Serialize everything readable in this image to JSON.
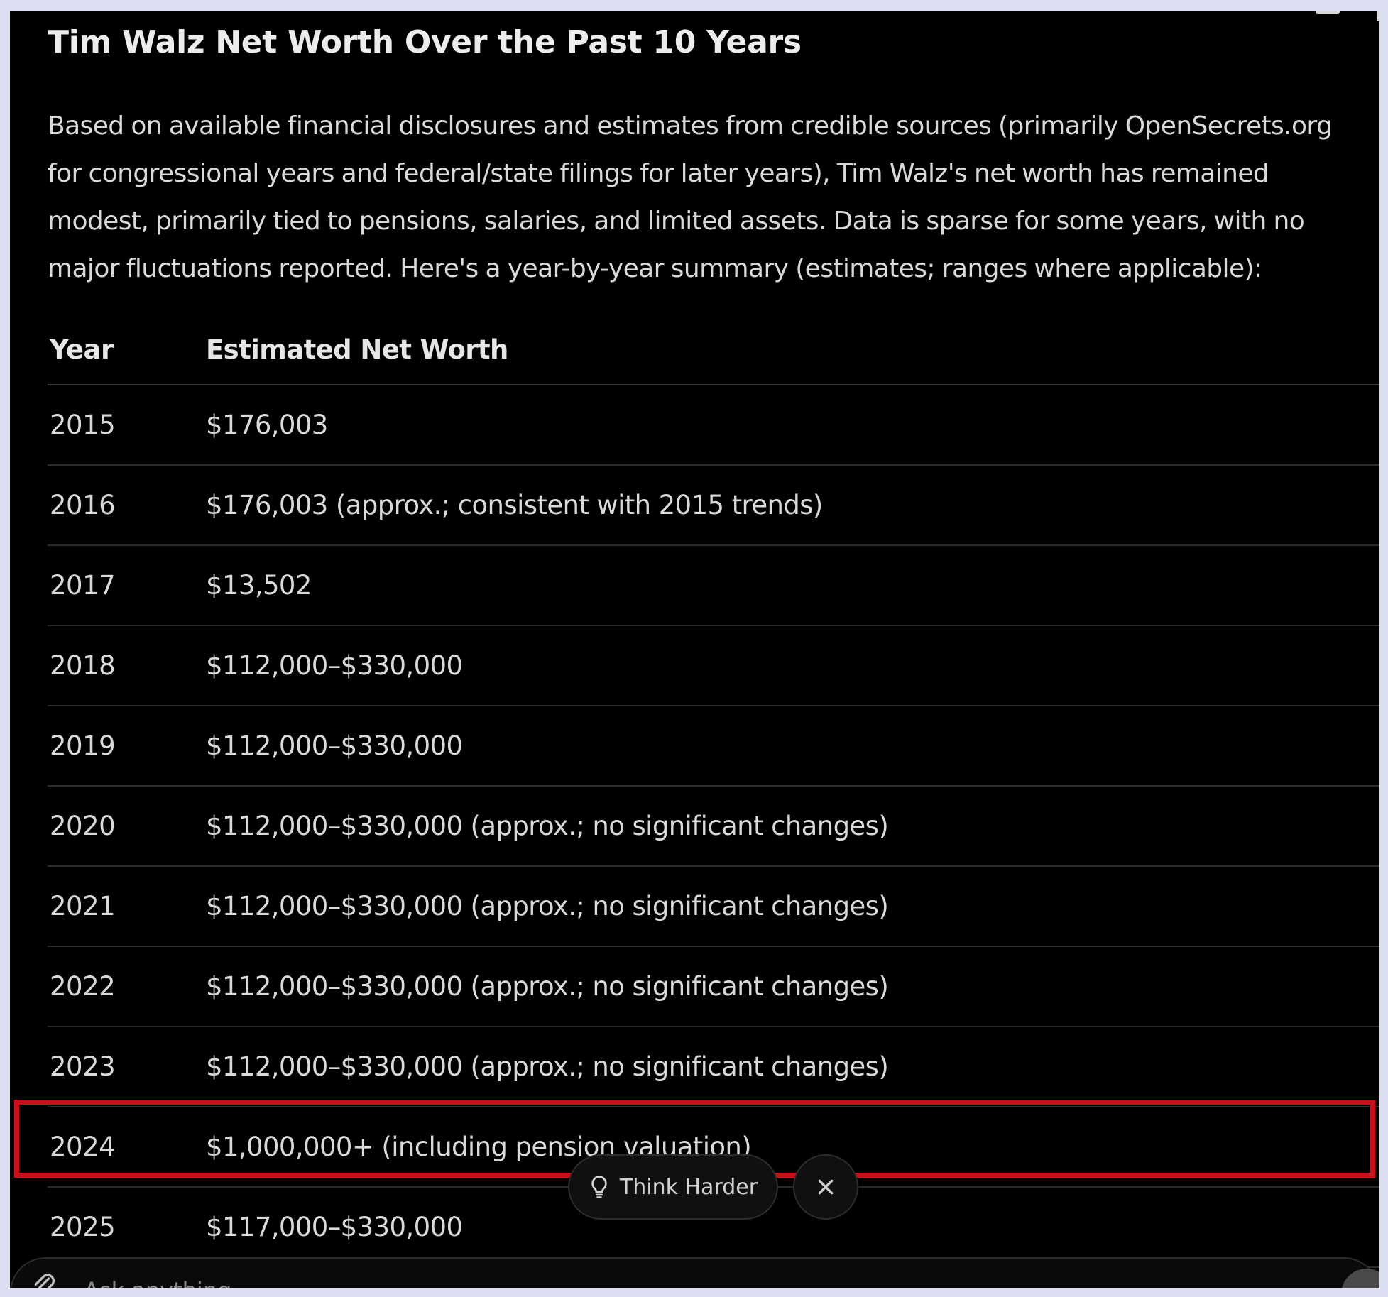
{
  "article": {
    "title": "Tim Walz Net Worth Over the Past 10 Years",
    "intro": "Based on available financial disclosures and estimates from credible sources (primarily OpenSecrets.org for congressional years and federal/state filings for later years), Tim Walz's net worth has remained modest, primarily tied to pensions, salaries, and limited assets. Data is sparse for some years, with no major fluctuations reported. Here's a year-by-year summary (estimates; ranges where applicable):"
  },
  "table": {
    "headers": [
      "Year",
      "Estimated Net Worth"
    ],
    "rows": [
      {
        "year": "2015",
        "worth": "$176,003"
      },
      {
        "year": "2016",
        "worth": "$176,003 (approx.; consistent with 2015 trends)"
      },
      {
        "year": "2017",
        "worth": "$13,502"
      },
      {
        "year": "2018",
        "worth": "$112,000–$330,000"
      },
      {
        "year": "2019",
        "worth": "$112,000–$330,000"
      },
      {
        "year": "2020",
        "worth": "$112,000–$330,000 (approx.; no significant changes)"
      },
      {
        "year": "2021",
        "worth": "$112,000–$330,000 (approx.; no significant changes)"
      },
      {
        "year": "2022",
        "worth": "$112,000–$330,000 (approx.; no significant changes)"
      },
      {
        "year": "2023",
        "worth": "$112,000–$330,000 (approx.; no significant changes)"
      },
      {
        "year": "2024",
        "worth": "$1,000,000+ (including pension valuation)"
      },
      {
        "year": "2025",
        "worth": "$117,000–$330,000"
      }
    ]
  },
  "actions": {
    "think_harder_label": "Think Harder",
    "think_harder_icon": "lightbulb-icon",
    "close_icon": "close-icon"
  },
  "composer": {
    "placeholder": "Ask anything"
  },
  "colors": {
    "background": "#000000",
    "frame": "#dcdff2",
    "highlight": "#c8111a",
    "text": "#d9d9d9"
  }
}
